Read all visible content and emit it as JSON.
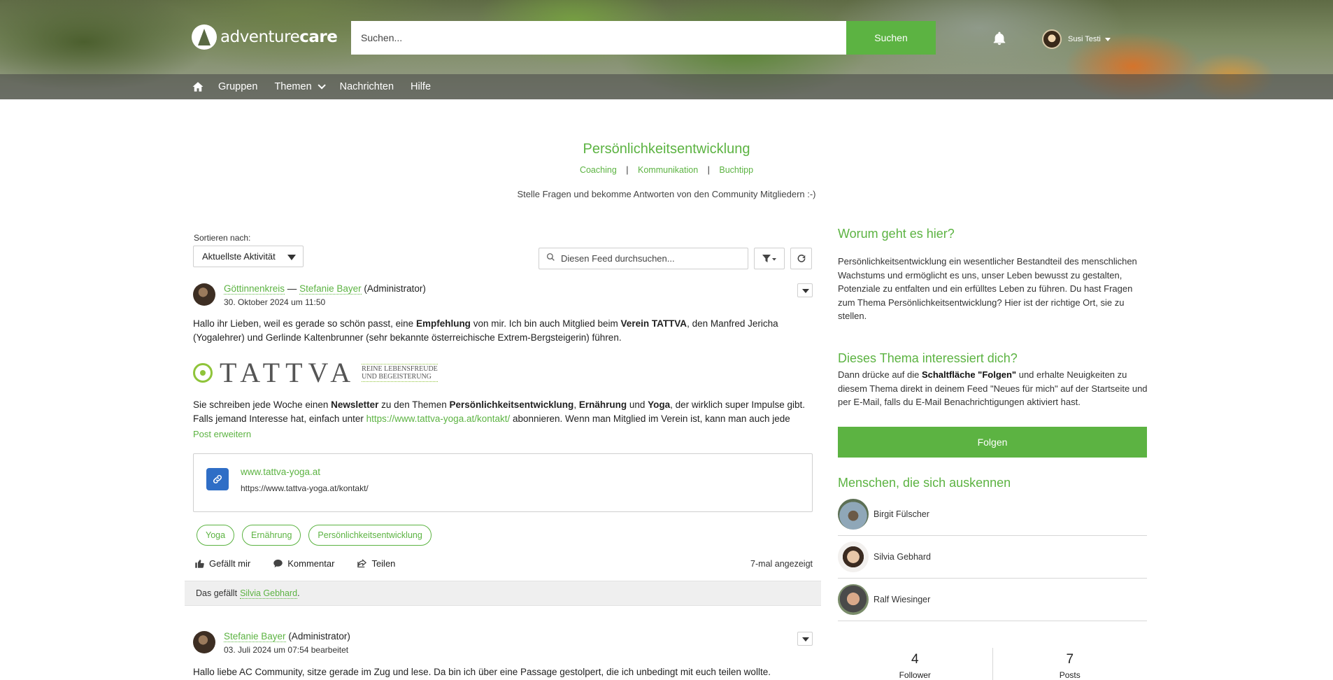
{
  "header": {
    "logo_text_a": "adventure",
    "logo_text_b": "care",
    "search_placeholder": "Suchen...",
    "search_button": "Suchen",
    "user_name": "Susi Testi"
  },
  "nav": {
    "items": [
      "Gruppen",
      "Themen",
      "Nachrichten",
      "Hilfe"
    ]
  },
  "topic": {
    "title": "Persönlichkeitsentwicklung",
    "subtopics": [
      "Coaching",
      "Kommunikation",
      "Buchtipp"
    ],
    "separator": "|",
    "tagline": "Stelle Fragen und bekomme Antworten von den Community Mitgliedern :-)"
  },
  "feed": {
    "sort_label": "Sortieren nach:",
    "sort_value": "Aktuellste Aktivität",
    "search_placeholder": "Diesen Feed durchsuchen..."
  },
  "post1": {
    "group": "Göttinnenkreis",
    "dash": " — ",
    "author": "Stefanie Bayer",
    "role": " (Administrator)",
    "date": "30. Oktober 2024 um 11:50",
    "p1_a": "Hallo ihr Lieben, weil es gerade so schön passt, eine ",
    "p1_b": "Empfehlung",
    "p1_c": " von mir. Ich bin auch Mitglied beim ",
    "p1_d": "Verein TATTVA",
    "p1_e": ", den Manfred Jericha (Yogalehrer) und Gerlinde Kaltenbrunner (sehr bekannte österreichische Extrem-Bergsteigerin) führen.",
    "logo_word": "TATTVA",
    "logo_sub1": "REINE LEBENSFREUDE",
    "logo_sub2": "UND BEGEISTERUNG",
    "p2_a": "Sie schreiben jede Woche einen ",
    "p2_b": "Newsletter",
    "p2_c": " zu den Themen ",
    "p2_d": "Persönlichkeitsentwicklung",
    "p2_e": ", ",
    "p2_f": "Ernährung",
    "p2_g": " und ",
    "p2_h": "Yoga",
    "p2_i": ", der wirklich super Impulse gibt. Falls jemand Interesse hat, einfach unter ",
    "p2_link": "https://www.tattva-yoga.at/kontakt/",
    "p2_j": " abonnieren. Wenn man Mitglied im Verein ist, kann man auch jede",
    "expand": "Post erweitern",
    "link_title": "www.tattva-yoga.at",
    "link_url": "https://www.tattva-yoga.at/kontakt/",
    "tags": [
      "Yoga",
      "Ernährung",
      "Persönlichkeitsentwicklung"
    ],
    "like": "Gefällt mir",
    "comment": "Kommentar",
    "share": "Teilen",
    "views": "7-mal angezeigt",
    "likes_prefix": "Das gefällt",
    "likes_user": "Silvia Gebhard",
    "likes_suffix": "."
  },
  "post2": {
    "author": "Stefanie Bayer",
    "role": " (Administrator)",
    "date": "03. Juli 2024 um 07:54 bearbeitet",
    "text": "Hallo liebe AC Community, sitze gerade im Zug und lese. Da bin ich über eine Passage gestolpert, die ich unbedingt mit euch teilen wollte."
  },
  "sidebar": {
    "about_title": "Worum geht es hier?",
    "about_text": "Persönlichkeitsentwicklung ein wesentlicher Bestandteil des menschlichen Wachstums und ermöglicht es uns, unser Leben bewusst zu gestalten, Potenziale zu entfalten und ein erfülltes Leben zu führen. Du hast Fragen zum Thema Persönlichkeitsentwicklung? Hier ist der richtige Ort, sie zu stellen.",
    "interest_title": "Dieses Thema interessiert dich?",
    "interest_a": "Dann drücke auf die ",
    "interest_b": "Schaltfläche \"Folgen\"",
    "interest_c": " und erhalte Neuigkeiten zu diesem Thema direkt in deinem Feed \"Neues für mich\" auf der Startseite und per E-Mail, falls du E-Mail Benachrichtigungen aktiviert hast.",
    "follow_button": "Folgen",
    "experts_title": "Menschen, die sich auskennen",
    "experts": [
      "Birgit Fülscher",
      "Silvia Gebhard",
      "Ralf Wiesinger"
    ],
    "stats": [
      {
        "value": "4",
        "label": "Follower"
      },
      {
        "value": "7",
        "label": "Posts"
      }
    ]
  },
  "colors": {
    "accent": "#5cb342",
    "link_icon": "#2f6ec6"
  }
}
